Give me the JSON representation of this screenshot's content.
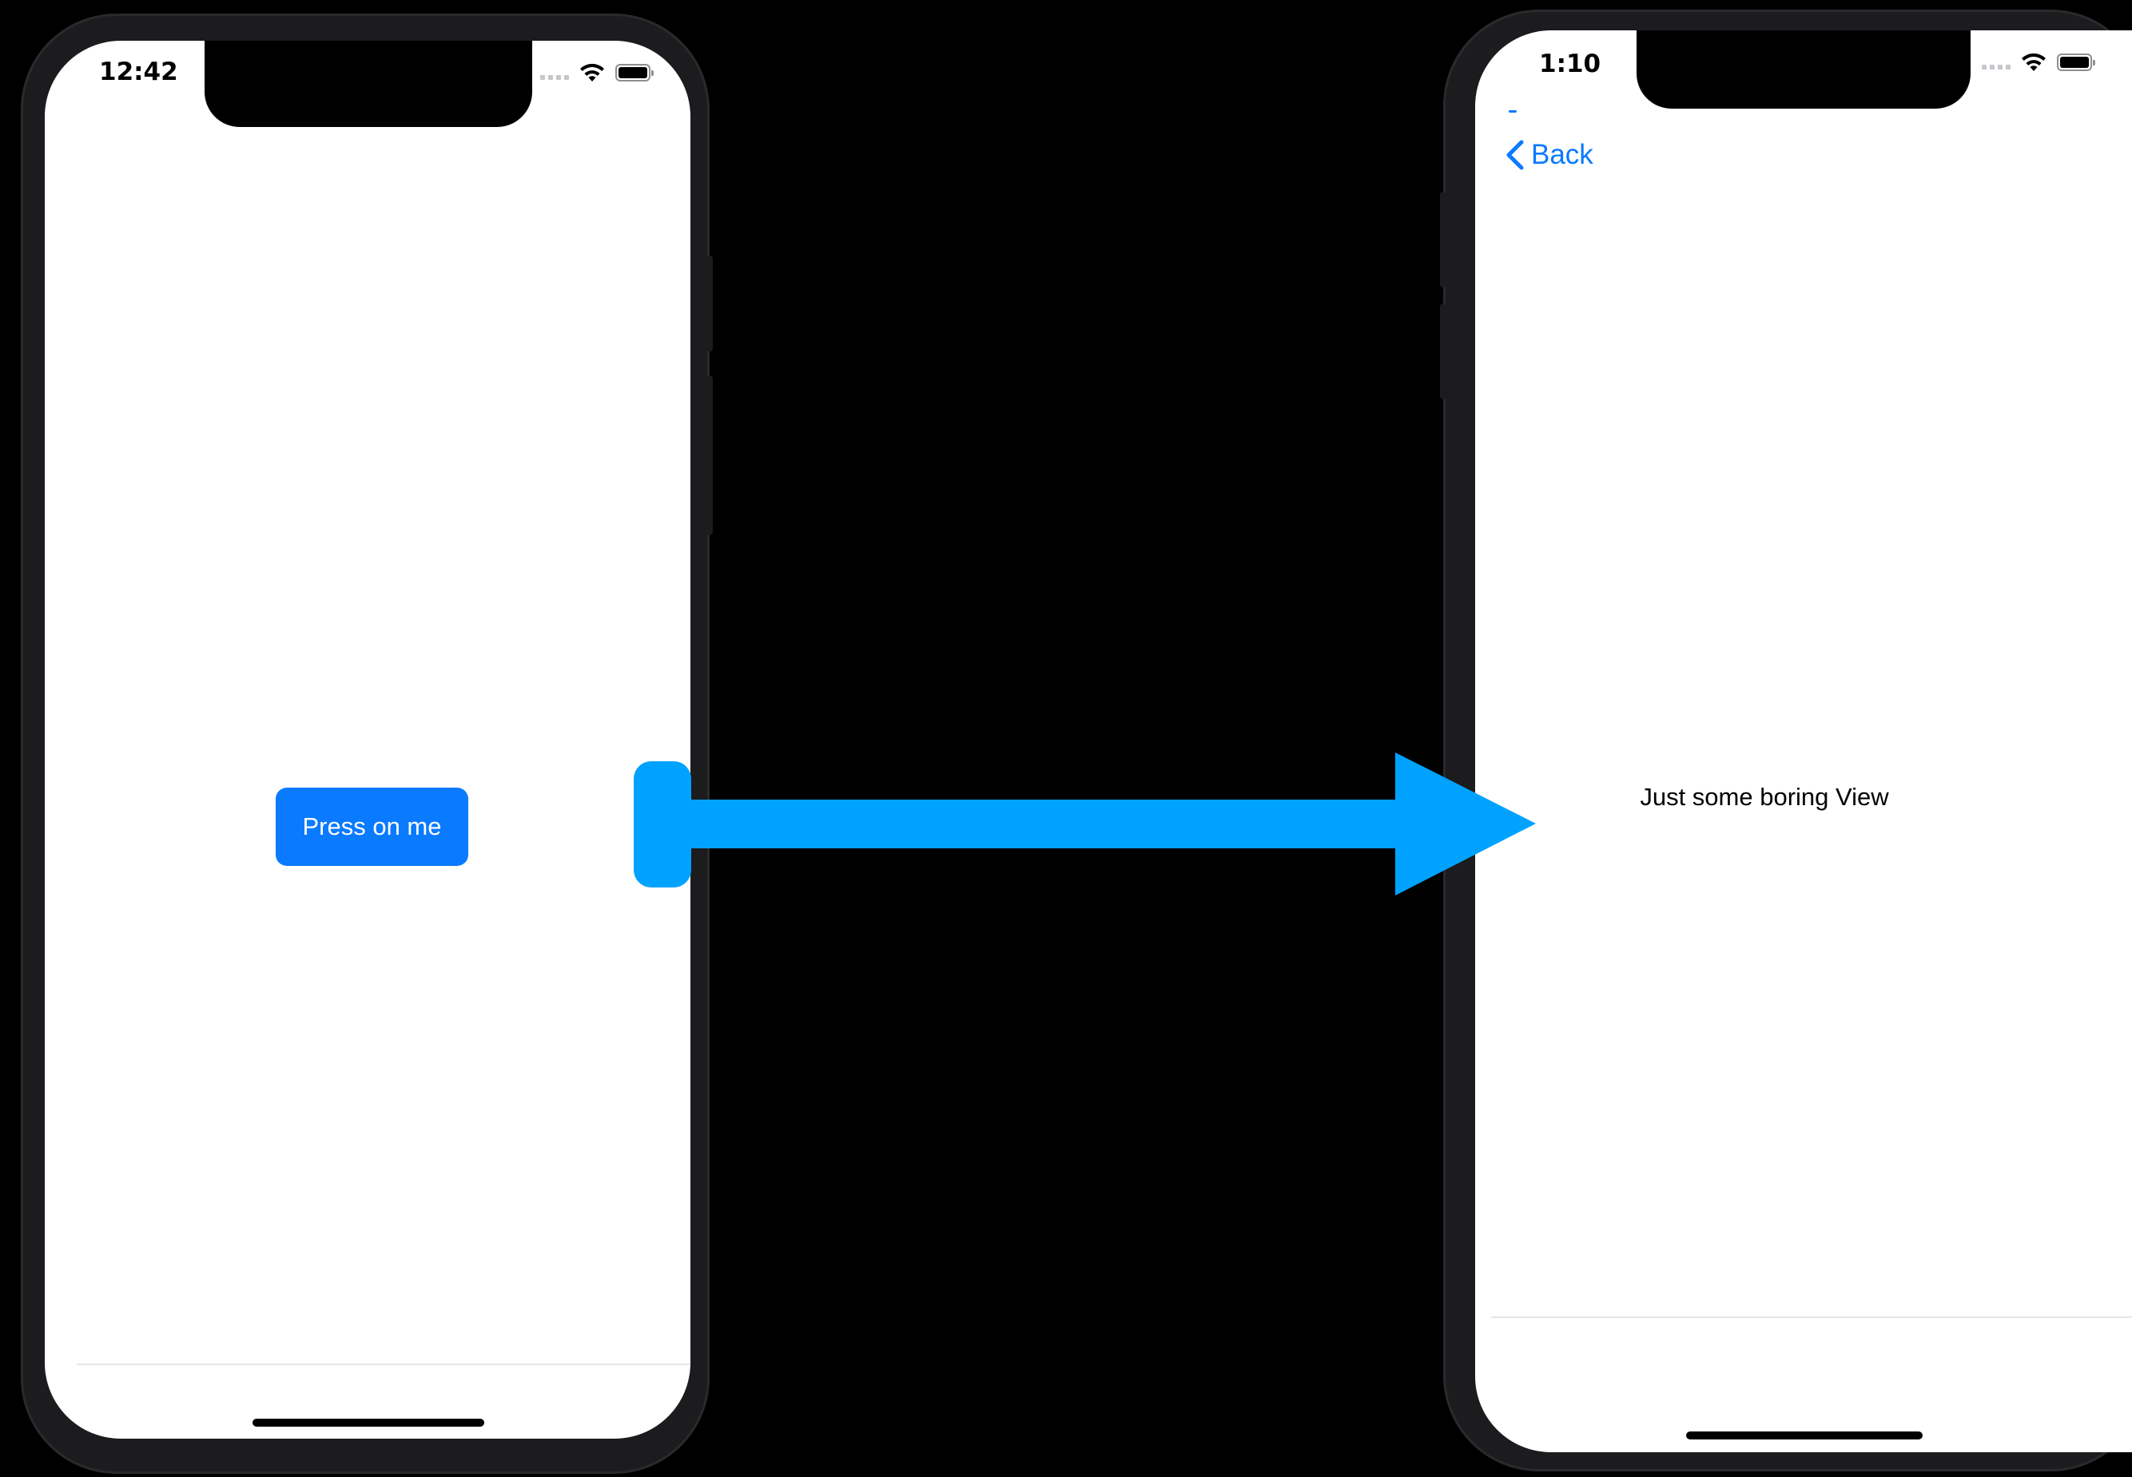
{
  "colors": {
    "ios_blue": "#0a7aff",
    "arrow_blue": "#00a2ff",
    "device_body": "#1c1c1e",
    "screen_bg": "#ffffff"
  },
  "left_screen": {
    "status_time": "12:42",
    "icons": [
      "cellular-signal-icon",
      "wifi-icon",
      "battery-icon"
    ],
    "button_label": "Press on me"
  },
  "right_screen": {
    "status_time": "1:10",
    "icons": [
      "cellular-signal-icon",
      "wifi-icon",
      "battery-icon"
    ],
    "nav": {
      "back_icon": "chevron-left-icon",
      "back_label": "Back"
    },
    "body_text": "Just some boring View"
  },
  "transition": {
    "icon": "arrow-right-icon"
  }
}
